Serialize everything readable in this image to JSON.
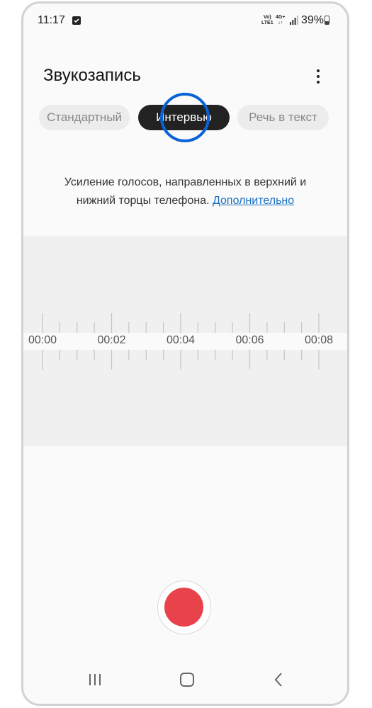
{
  "status_bar": {
    "time": "11:17",
    "volte_line1": "Vo)",
    "volte_line2": "LTE1",
    "net_line1": "4G+",
    "net_line2": "↓↑",
    "battery": "39%",
    "battery_level": 0.39
  },
  "header": {
    "title": "Звукозапись"
  },
  "tabs": [
    {
      "label": "Стандартный",
      "selected": false
    },
    {
      "label": "Интервью",
      "selected": true
    },
    {
      "label": "Речь в текст",
      "selected": false
    }
  ],
  "description": {
    "line1": "Усиление голосов, направленных в верхний и",
    "line2": "нижний торцы телефона.",
    "link": "Дополнительно"
  },
  "timeline": {
    "labels": [
      "00:00",
      "00:02",
      "00:04",
      "00:06",
      "00:08"
    ]
  },
  "colors": {
    "accent": "#0a63d6",
    "record": "#e8434a",
    "selected_tab": "#222222",
    "link": "#1a6fc2"
  },
  "icons": {
    "more": "more-vertical-icon",
    "record": "record-icon",
    "recent": "recent-apps-icon",
    "home": "home-icon",
    "back": "back-icon"
  }
}
